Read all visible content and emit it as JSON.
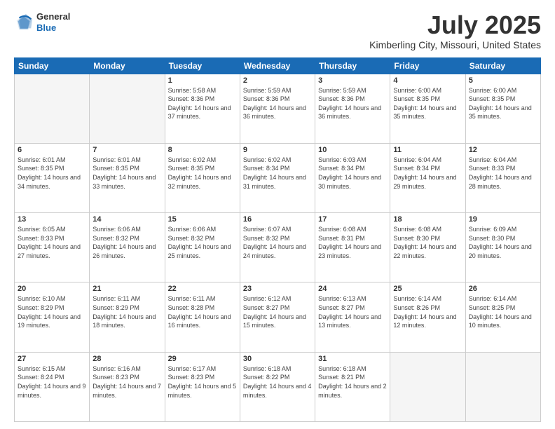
{
  "header": {
    "logo": {
      "general": "General",
      "blue": "Blue"
    },
    "title": "July 2025",
    "location": "Kimberling City, Missouri, United States"
  },
  "days_of_week": [
    "Sunday",
    "Monday",
    "Tuesday",
    "Wednesday",
    "Thursday",
    "Friday",
    "Saturday"
  ],
  "weeks": [
    [
      {
        "day": "",
        "empty": true
      },
      {
        "day": "",
        "empty": true
      },
      {
        "day": "1",
        "sunrise": "5:58 AM",
        "sunset": "8:36 PM",
        "daylight": "14 hours and 37 minutes."
      },
      {
        "day": "2",
        "sunrise": "5:59 AM",
        "sunset": "8:36 PM",
        "daylight": "14 hours and 36 minutes."
      },
      {
        "day": "3",
        "sunrise": "5:59 AM",
        "sunset": "8:36 PM",
        "daylight": "14 hours and 36 minutes."
      },
      {
        "day": "4",
        "sunrise": "6:00 AM",
        "sunset": "8:35 PM",
        "daylight": "14 hours and 35 minutes."
      },
      {
        "day": "5",
        "sunrise": "6:00 AM",
        "sunset": "8:35 PM",
        "daylight": "14 hours and 35 minutes."
      }
    ],
    [
      {
        "day": "6",
        "sunrise": "6:01 AM",
        "sunset": "8:35 PM",
        "daylight": "14 hours and 34 minutes."
      },
      {
        "day": "7",
        "sunrise": "6:01 AM",
        "sunset": "8:35 PM",
        "daylight": "14 hours and 33 minutes."
      },
      {
        "day": "8",
        "sunrise": "6:02 AM",
        "sunset": "8:35 PM",
        "daylight": "14 hours and 32 minutes."
      },
      {
        "day": "9",
        "sunrise": "6:02 AM",
        "sunset": "8:34 PM",
        "daylight": "14 hours and 31 minutes."
      },
      {
        "day": "10",
        "sunrise": "6:03 AM",
        "sunset": "8:34 PM",
        "daylight": "14 hours and 30 minutes."
      },
      {
        "day": "11",
        "sunrise": "6:04 AM",
        "sunset": "8:34 PM",
        "daylight": "14 hours and 29 minutes."
      },
      {
        "day": "12",
        "sunrise": "6:04 AM",
        "sunset": "8:33 PM",
        "daylight": "14 hours and 28 minutes."
      }
    ],
    [
      {
        "day": "13",
        "sunrise": "6:05 AM",
        "sunset": "8:33 PM",
        "daylight": "14 hours and 27 minutes."
      },
      {
        "day": "14",
        "sunrise": "6:06 AM",
        "sunset": "8:32 PM",
        "daylight": "14 hours and 26 minutes."
      },
      {
        "day": "15",
        "sunrise": "6:06 AM",
        "sunset": "8:32 PM",
        "daylight": "14 hours and 25 minutes."
      },
      {
        "day": "16",
        "sunrise": "6:07 AM",
        "sunset": "8:32 PM",
        "daylight": "14 hours and 24 minutes."
      },
      {
        "day": "17",
        "sunrise": "6:08 AM",
        "sunset": "8:31 PM",
        "daylight": "14 hours and 23 minutes."
      },
      {
        "day": "18",
        "sunrise": "6:08 AM",
        "sunset": "8:30 PM",
        "daylight": "14 hours and 22 minutes."
      },
      {
        "day": "19",
        "sunrise": "6:09 AM",
        "sunset": "8:30 PM",
        "daylight": "14 hours and 20 minutes."
      }
    ],
    [
      {
        "day": "20",
        "sunrise": "6:10 AM",
        "sunset": "8:29 PM",
        "daylight": "14 hours and 19 minutes."
      },
      {
        "day": "21",
        "sunrise": "6:11 AM",
        "sunset": "8:29 PM",
        "daylight": "14 hours and 18 minutes."
      },
      {
        "day": "22",
        "sunrise": "6:11 AM",
        "sunset": "8:28 PM",
        "daylight": "14 hours and 16 minutes."
      },
      {
        "day": "23",
        "sunrise": "6:12 AM",
        "sunset": "8:27 PM",
        "daylight": "14 hours and 15 minutes."
      },
      {
        "day": "24",
        "sunrise": "6:13 AM",
        "sunset": "8:27 PM",
        "daylight": "14 hours and 13 minutes."
      },
      {
        "day": "25",
        "sunrise": "6:14 AM",
        "sunset": "8:26 PM",
        "daylight": "14 hours and 12 minutes."
      },
      {
        "day": "26",
        "sunrise": "6:14 AM",
        "sunset": "8:25 PM",
        "daylight": "14 hours and 10 minutes."
      }
    ],
    [
      {
        "day": "27",
        "sunrise": "6:15 AM",
        "sunset": "8:24 PM",
        "daylight": "14 hours and 9 minutes."
      },
      {
        "day": "28",
        "sunrise": "6:16 AM",
        "sunset": "8:23 PM",
        "daylight": "14 hours and 7 minutes."
      },
      {
        "day": "29",
        "sunrise": "6:17 AM",
        "sunset": "8:23 PM",
        "daylight": "14 hours and 5 minutes."
      },
      {
        "day": "30",
        "sunrise": "6:18 AM",
        "sunset": "8:22 PM",
        "daylight": "14 hours and 4 minutes."
      },
      {
        "day": "31",
        "sunrise": "6:18 AM",
        "sunset": "8:21 PM",
        "daylight": "14 hours and 2 minutes."
      },
      {
        "day": "",
        "empty": true
      },
      {
        "day": "",
        "empty": true
      }
    ]
  ]
}
